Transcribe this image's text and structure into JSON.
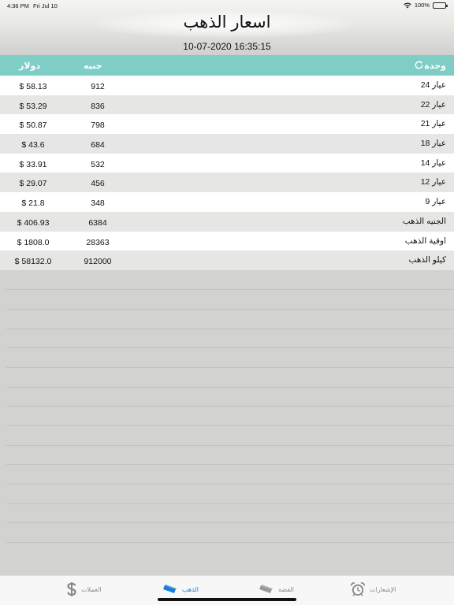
{
  "status_bar": {
    "time": "4:36 PM",
    "date": "Fri Jul 10",
    "battery": "100%"
  },
  "header": {
    "title": "اسعار الذهب",
    "timestamp": "10-07-2020 16:35:15"
  },
  "table": {
    "columns": {
      "dollar": "دولار",
      "pound": "جنيه",
      "unit": "وحدة"
    },
    "rows": [
      {
        "unit": "عيار 24",
        "pound": "912",
        "dollar": "$ 58.13"
      },
      {
        "unit": "عيار 22",
        "pound": "836",
        "dollar": "$ 53.29"
      },
      {
        "unit": "عيار 21",
        "pound": "798",
        "dollar": "$ 50.87"
      },
      {
        "unit": "عيار 18",
        "pound": "684",
        "dollar": "$ 43.6"
      },
      {
        "unit": "عيار 14",
        "pound": "532",
        "dollar": "$ 33.91"
      },
      {
        "unit": "عيار 12",
        "pound": "456",
        "dollar": "$ 29.07"
      },
      {
        "unit": "عيار 9",
        "pound": "348",
        "dollar": "$ 21.8"
      },
      {
        "unit": "الجنيه الذهب",
        "pound": "6384",
        "dollar": "$ 406.93"
      },
      {
        "unit": "اوقية الذهب",
        "pound": "28363",
        "dollar": "$ 1808.0"
      },
      {
        "unit": "كيلو الذهب",
        "pound": "912000",
        "dollar": "$ 58132.0"
      }
    ]
  },
  "tab_bar": {
    "tabs": [
      {
        "label": "العملات",
        "icon": "dollar-icon",
        "active": false
      },
      {
        "label": "الذهب",
        "icon": "gold-bar-icon",
        "active": true
      },
      {
        "label": "الفضة",
        "icon": "silver-bar-icon",
        "active": false
      },
      {
        "label": "الإشعارات",
        "icon": "alarm-clock-icon",
        "active": false
      }
    ]
  },
  "colors": {
    "header_teal": "#7ecdc6",
    "active_tab": "#1a7dd6",
    "inactive_tab": "#888888"
  }
}
